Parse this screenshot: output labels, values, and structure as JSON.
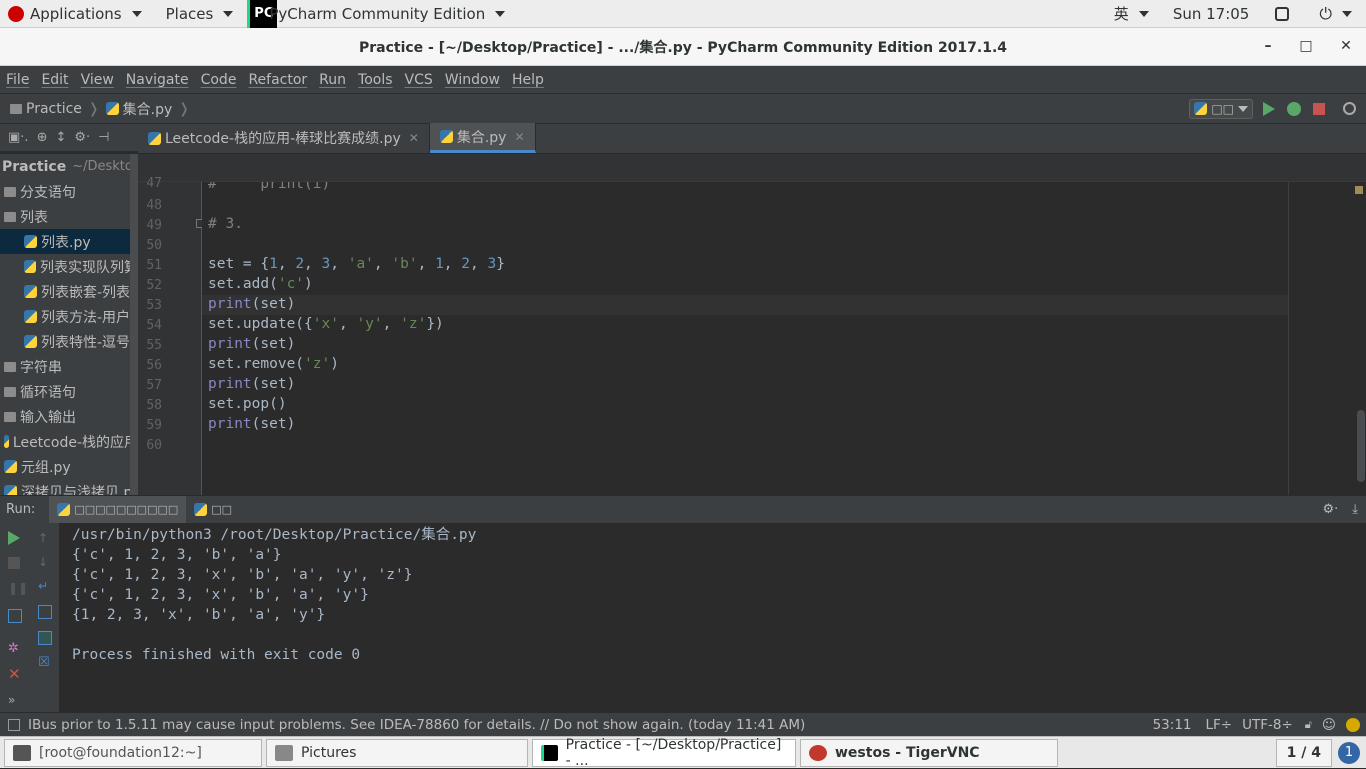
{
  "topbar": {
    "applications": "Applications",
    "places": "Places",
    "active_app": "PyCharm Community Edition",
    "ime": "英",
    "clock": "Sun 17:05"
  },
  "window": {
    "title": "Practice - [~/Desktop/Practice] - .../集合.py - PyCharm Community Edition 2017.1.4"
  },
  "menu": [
    "File",
    "Edit",
    "View",
    "Navigate",
    "Code",
    "Refactor",
    "Run",
    "Tools",
    "VCS",
    "Window",
    "Help"
  ],
  "navbar": {
    "project": "Practice",
    "file": "集合.py",
    "run_config": "□□"
  },
  "tabs": [
    {
      "label": "Leetcode-栈的应用-棒球比赛成绩.py",
      "active": false
    },
    {
      "label": "集合.py",
      "active": true
    }
  ],
  "project_tree": {
    "root_label": "Practice",
    "root_path": "~/Desktop/P",
    "items": [
      {
        "label": "分支语句",
        "type": "folder",
        "indent": 0
      },
      {
        "label": "列表",
        "type": "folder",
        "indent": 0
      },
      {
        "label": "列表.py",
        "type": "py",
        "indent": 1,
        "selected": true
      },
      {
        "label": "列表实现队列算",
        "type": "py",
        "indent": 1
      },
      {
        "label": "列表嵌套-列表",
        "type": "py",
        "indent": 1
      },
      {
        "label": "列表方法-用户",
        "type": "py",
        "indent": 1
      },
      {
        "label": "列表特性-逗号",
        "type": "py",
        "indent": 1
      },
      {
        "label": "字符串",
        "type": "folder",
        "indent": 0
      },
      {
        "label": "循环语句",
        "type": "folder",
        "indent": 0
      },
      {
        "label": "输入输出",
        "type": "folder",
        "indent": 0
      },
      {
        "label": "Leetcode-栈的应用",
        "type": "py",
        "indent": 0
      },
      {
        "label": "元组.py",
        "type": "py",
        "indent": 0
      },
      {
        "label": "深拷贝与浅拷贝.p",
        "type": "py",
        "indent": 0
      }
    ]
  },
  "editor": {
    "line_numbers": [
      "47",
      "48",
      "49",
      "50",
      "51",
      "52",
      "53",
      "54",
      "55",
      "56",
      "57",
      "58",
      "59",
      "60"
    ],
    "lines": [
      "#     print(i)",
      "",
      "# 3.",
      "",
      "set = {1, 2, 3, 'a', 'b', 1, 2, 3}",
      "set.add('c')",
      "print(set)",
      "set.update({'x', 'y', 'z'})",
      "print(set)",
      "set.remove('z')",
      "print(set)",
      "set.pop()",
      "print(set)",
      ""
    ]
  },
  "run": {
    "label": "Run:",
    "tab1": "□□□□□□□□□□",
    "tab2": "□□",
    "output": [
      "/usr/bin/python3 /root/Desktop/Practice/集合.py",
      "{'c', 1, 2, 3, 'b', 'a'}",
      "{'c', 1, 2, 3, 'x', 'b', 'a', 'y', 'z'}",
      "{'c', 1, 2, 3, 'x', 'b', 'a', 'y'}",
      "{1, 2, 3, 'x', 'b', 'a', 'y'}",
      "",
      "Process finished with exit code 0"
    ]
  },
  "status": {
    "message": "IBus prior to 1.5.11 may cause input problems. See IDEA-78860 for details. // Do not show again. (today 11:41 AM)",
    "position": "53:11",
    "line_sep": "LF÷",
    "encoding": "UTF-8÷"
  },
  "taskbar": {
    "items": [
      {
        "label": "[root@foundation12:~]",
        "active": false
      },
      {
        "label": "Pictures",
        "active": false
      },
      {
        "label": "Practice - [~/Desktop/Practice] - ...",
        "active": true
      },
      {
        "label": "westos - TigerVNC",
        "active": false
      }
    ],
    "workspace": "1 / 4"
  }
}
